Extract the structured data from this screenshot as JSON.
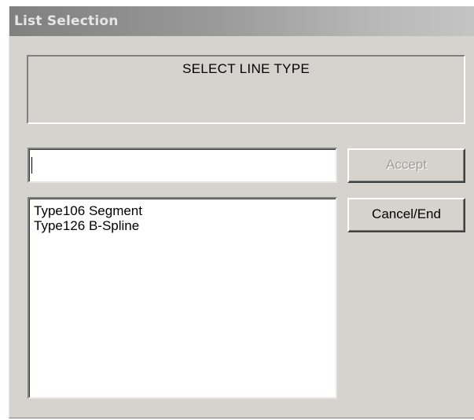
{
  "window": {
    "title": "List Selection"
  },
  "prompt": {
    "text": "SELECT LINE TYPE"
  },
  "entry": {
    "value": ""
  },
  "list": {
    "items": [
      {
        "label": "Type106 Segment"
      },
      {
        "label": "Type126 B-Spline"
      }
    ]
  },
  "buttons": {
    "accept_label": "Accept",
    "accept_enabled": false,
    "cancel_label": "Cancel/End"
  },
  "colors": {
    "titlebar_start": "#808080",
    "titlebar_end": "#c4c4c4",
    "dialog_background": "#d6d3ce",
    "disabled_text": "#a09d98"
  }
}
